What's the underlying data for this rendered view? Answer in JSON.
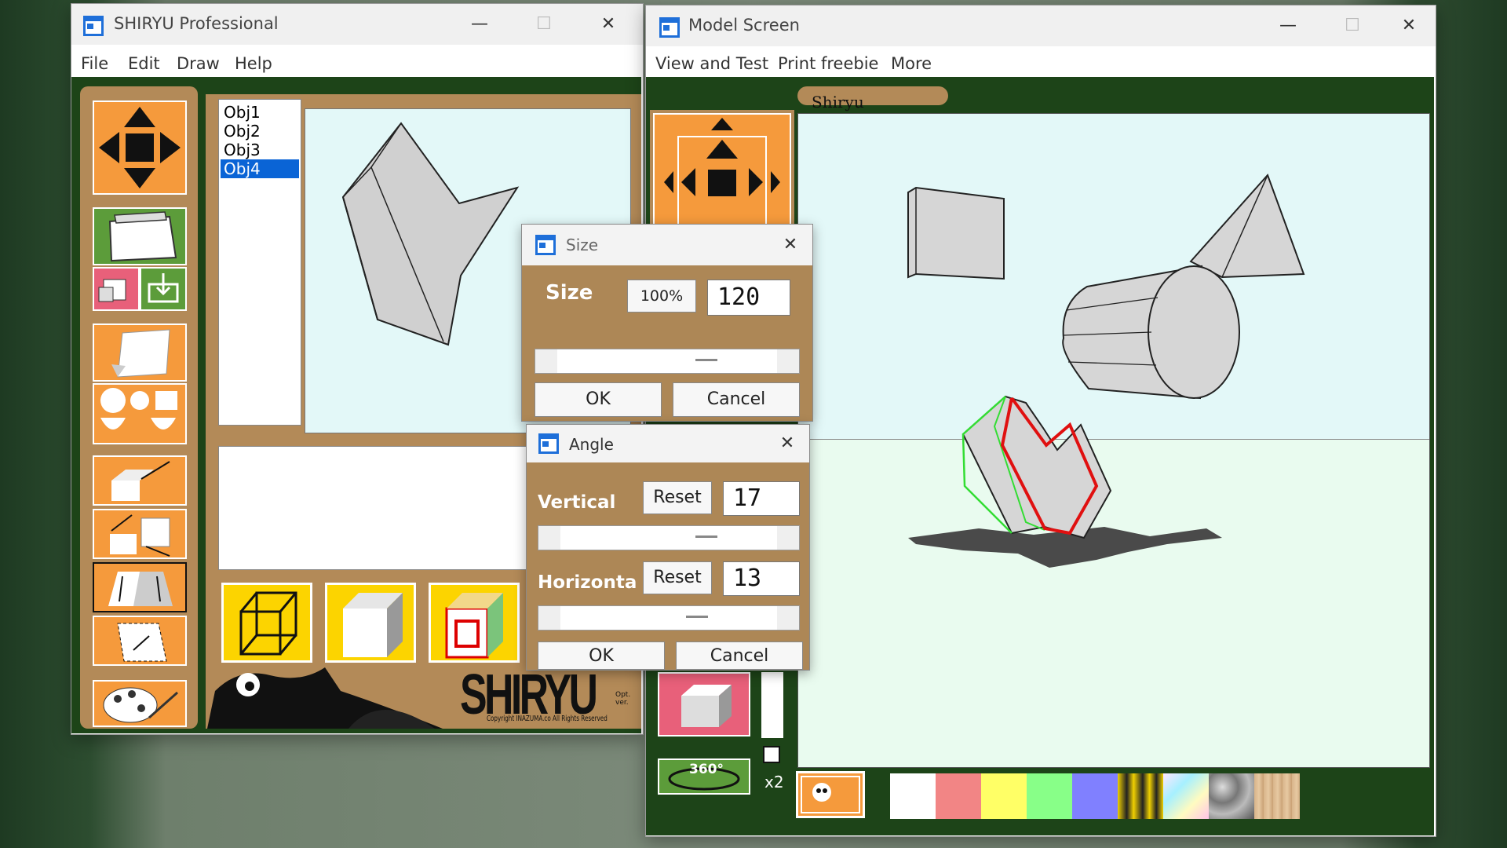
{
  "main_window": {
    "title": "SHIRYU Professional",
    "menu": [
      "File",
      "Edit",
      "Draw",
      "Help"
    ],
    "objects": [
      "Obj1",
      "Obj2",
      "Obj3",
      "Obj4"
    ],
    "selected_object": "Obj4",
    "logo_text": "SHIRYU",
    "logo_side": "Opt. ver.",
    "copyright": "Copyright INAZUMA.co All Rights Reserved"
  },
  "model_window": {
    "title": "Model Screen",
    "menu": [
      "View and Test",
      "Print freebie",
      "More"
    ],
    "tab_label": "Shiryu",
    "rotate_label": "360°",
    "zoom_label": "x2"
  },
  "size_dialog": {
    "title": "Size",
    "label": "Size",
    "percent_button": "100%",
    "value": "120",
    "ok": "OK",
    "cancel": "Cancel"
  },
  "angle_dialog": {
    "title": "Angle",
    "vertical_label": "Vertical",
    "vertical_reset": "Reset",
    "vertical_value": "17",
    "horizontal_label": "Horizonta",
    "horizontal_reset": "Reset",
    "horizontal_value": "13",
    "ok": "OK",
    "cancel": "Cancel"
  },
  "colors": {
    "accent_orange": "#f59a3c",
    "frame_green": "#1d4418",
    "tan": "#b38a58",
    "sky": "#e3f8f8",
    "ground": "#e9fbef",
    "selection_blue": "#0a64d6",
    "highlight_red": "#e01010",
    "highlight_green": "#33dd33"
  },
  "swatches": [
    "#ffffff",
    "#f28585",
    "#ffff66",
    "#88ff88",
    "#8080ff"
  ],
  "icons": [
    "app-icon",
    "minimize-icon",
    "maximize-icon",
    "close-icon",
    "move-arrows-icon",
    "folder-icon",
    "save-icon",
    "paint-palette-icon",
    "wireframe-cube-icon",
    "solid-cube-icon",
    "texture-cube-icon",
    "rotate-360-icon",
    "photo-icon"
  ]
}
